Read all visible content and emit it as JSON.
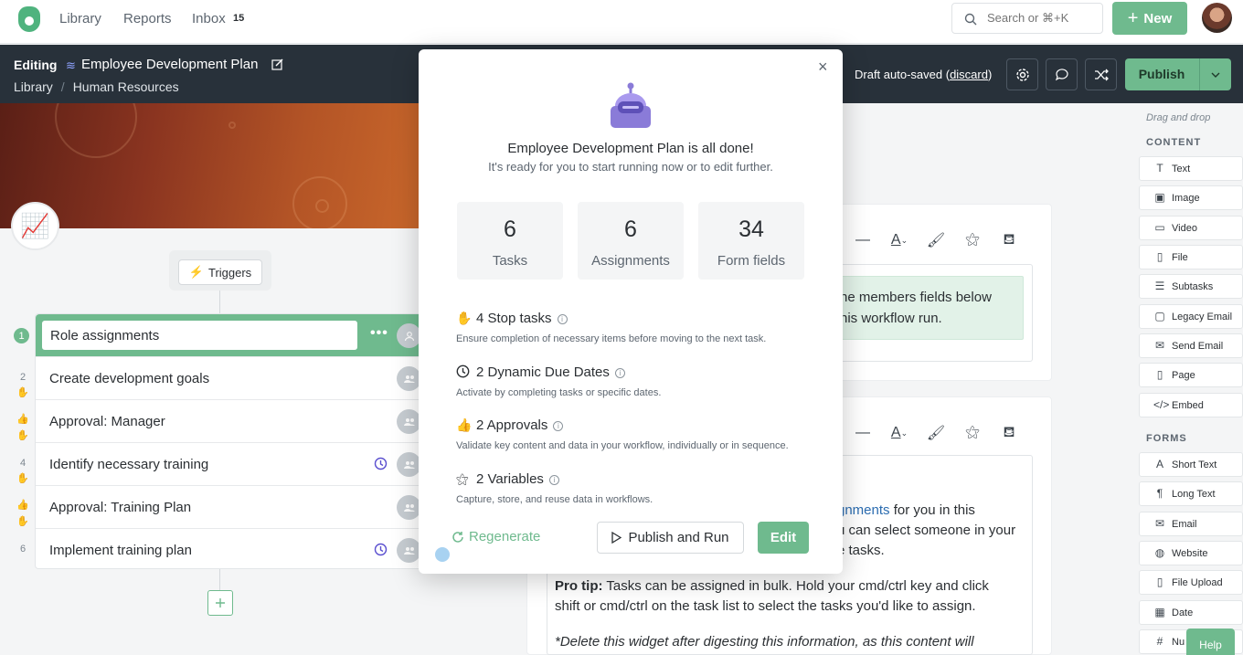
{
  "nav": {
    "library": "Library",
    "reports": "Reports",
    "inbox": "Inbox",
    "inbox_count": "15",
    "search_placeholder": "Search or ⌘+K",
    "new_label": "New"
  },
  "header": {
    "editing": "Editing",
    "title": "Employee Development Plan",
    "breadcrumb": [
      "Library",
      "Human Resources"
    ],
    "autosaved": "Draft auto-saved",
    "discard": "discard",
    "publish": "Publish"
  },
  "triggers": "Triggers",
  "tasks": [
    {
      "num": "1",
      "name": "Role assignments"
    },
    {
      "num": "2",
      "name": "Create development goals"
    },
    {
      "num": "",
      "name": "Approval: Manager"
    },
    {
      "num": "4",
      "name": "Identify necessary training"
    },
    {
      "num": "",
      "name": "Approval: Training Plan"
    },
    {
      "num": "6",
      "name": "Implement training plan"
    }
  ],
  "editor": {
    "green_line1": "he members fields below",
    "green_line2": "his workflow run.",
    "line_a_pre": "",
    "line_a_link": "gnments",
    "line_a_post": " for you in this",
    "line_b": "u can select someone in your",
    "line_c": "e tasks.",
    "protip_label": "Pro tip:",
    "protip_text": " Tasks can be assigned in bulk. Hold your cmd/ctrl key and click",
    "protip_line2": "shift or cmd/ctrl on the task list to select the tasks you'd like to assign.",
    "delete_note": "*Delete this widget after digesting this information, as this content will"
  },
  "sidebar": {
    "drag_hint": "Drag and drop",
    "content_head": "CONTENT",
    "content_items": [
      "Text",
      "Image",
      "Video",
      "File",
      "Subtasks",
      "Legacy Email",
      "Send Email",
      "Page",
      "Embed"
    ],
    "forms_head": "FORMS",
    "form_items": [
      "Short Text",
      "Long Text",
      "Email",
      "Website",
      "File Upload",
      "Date",
      "Nu"
    ],
    "help": "Help"
  },
  "modal": {
    "title": "Employee Development Plan is all done!",
    "subtitle": "It's ready for you to start running now or to edit further.",
    "stats": [
      {
        "value": "6",
        "label": "Tasks"
      },
      {
        "value": "6",
        "label": "Assignments"
      },
      {
        "value": "34",
        "label": "Form fields"
      }
    ],
    "features": [
      {
        "title": "4 Stop tasks",
        "desc": "Ensure completion of necessary items before moving to the next task."
      },
      {
        "title": "2 Dynamic Due Dates",
        "desc": "Activate by completing tasks or specific dates."
      },
      {
        "title": "2 Approvals",
        "desc": "Validate key content and data in your workflow, individually or in sequence."
      },
      {
        "title": "2 Variables",
        "desc": "Capture, store, and reuse data in workflows."
      }
    ],
    "regenerate": "Regenerate",
    "publish_run": "Publish and Run",
    "edit": "Edit"
  },
  "colors": {
    "brand_green": "#6fba8e",
    "dark_header": "#28313a"
  }
}
